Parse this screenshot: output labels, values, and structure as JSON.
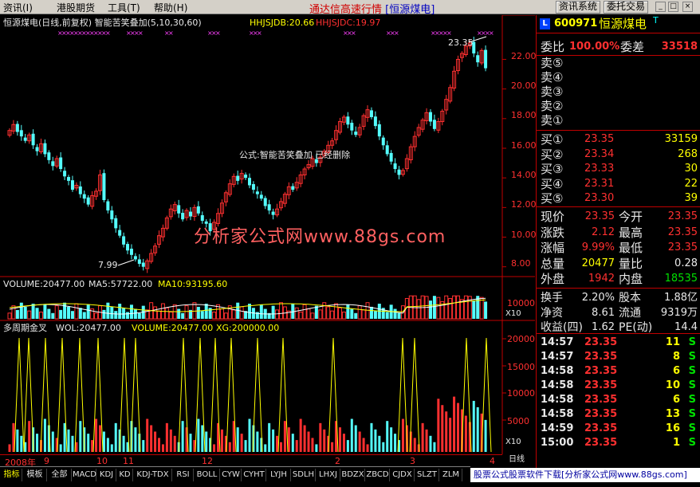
{
  "menu": {
    "items": [
      "资讯(I)",
      "港股期货",
      "工具(T)",
      "帮助(H)"
    ],
    "title_main": "通达信高速行情",
    "title_stock": "[恒源煤电]",
    "btn_news": "资讯系统",
    "btn_trade": "委托交易",
    "btn_min": "_",
    "btn_max": "□",
    "btn_close": "×"
  },
  "chart": {
    "header_title": "恒源煤电(日线,前复权) 智能苦笑叠加(5,10,30,60)",
    "hhjsjdb": "HHJSJDB:20.66",
    "hhjsjdc": "HHJSJDC:19.97",
    "formula_note": "公式:智能苦笑叠加 已经删除",
    "watermark": "分析家公式网www.88gs.com",
    "low_label": "7.99",
    "high_label": "23.35",
    "price_ticks": [
      "22.00",
      "20.00",
      "18.00",
      "16.00",
      "14.00",
      "12.00",
      "10.00",
      "8.00"
    ],
    "volume_header_a": "VOLUME:20477.00",
    "volume_header_b": "MA5:57722.00",
    "volume_header_c": "MA10:93195.60",
    "volume_tick": "10000",
    "volume_x10": "X10",
    "ind_header_a": "多周期金叉",
    "ind_header_b": "WOL:20477.00",
    "ind_header_c": "VOLUME:20477.00",
    "ind_header_d": "XG:200000.00",
    "ind_ticks": [
      "20000",
      "15000",
      "10000",
      "5000"
    ],
    "ind_x10": "X10",
    "time_labels": [
      "2008年",
      "9",
      "10",
      "11",
      "12",
      "2",
      "3",
      "4"
    ],
    "day_label": "日线",
    "colors": {
      "up": "#ff3030",
      "down": "#54fcfc",
      "yellow": "#ffff00",
      "grid": "#c00000"
    }
  },
  "chart_data": {
    "type": "candlestick",
    "price_range": [
      7.5,
      23.8
    ],
    "closes": [
      17.2,
      17.6,
      17.1,
      16.8,
      16.5,
      16.9,
      16.2,
      15.8,
      16.3,
      15.6,
      15.2,
      14.8,
      15.3,
      14.6,
      14.1,
      13.8,
      13.2,
      13.5,
      12.9,
      12.6,
      12.2,
      12.8,
      13.1,
      14.2,
      12.5,
      11.8,
      11.2,
      10.6,
      10.1,
      9.5,
      9.1,
      8.8,
      8.5,
      8.2,
      8.0,
      8.4,
      8.9,
      9.4,
      10.1,
      10.6,
      11.3,
      11.9,
      12.2,
      11.6,
      11.2,
      11.8,
      11.4,
      12.0,
      11.6,
      11.1,
      10.9,
      10.4,
      11.0,
      11.6,
      12.3,
      13.0,
      13.6,
      14.1,
      13.8,
      14.3,
      14.0,
      13.5,
      13.2,
      12.9,
      12.6,
      12.1,
      11.8,
      11.5,
      11.9,
      12.4,
      12.9,
      13.4,
      13.2,
      13.7,
      14.2,
      14.6,
      14.9,
      15.3,
      15.0,
      15.4,
      15.8,
      16.2,
      16.5,
      17.2,
      17.8,
      18.1,
      17.6,
      17.2,
      16.9,
      17.4,
      18.2,
      18.6,
      18.1,
      17.5,
      16.8,
      16.2,
      15.6,
      15.1,
      14.6,
      14.2,
      14.5,
      15.3,
      16.1,
      16.8,
      17.4,
      17.9,
      18.4,
      17.8,
      17.3,
      17.8,
      18.5,
      19.3,
      20.1,
      21.2,
      22.0,
      22.4,
      22.9,
      23.1,
      22.4,
      21.8,
      22.6,
      21.4
    ],
    "volume_header": "VOLUME:20477.00 MA5:57722.00 MA10:93195.60",
    "indicator_header": "多周期金叉 WOL:20477.00 VOLUME:20477.00 XG:200000.00"
  },
  "quote": {
    "code": "600971",
    "name": "恒源煤电",
    "logo": "L",
    "tag": "T",
    "weibi_label": "委比",
    "weibi_value": "100.00%",
    "weicha_label": "委差",
    "weicha_value": "33518",
    "sell": [
      {
        "label": "卖⑤",
        "price": "",
        "vol": ""
      },
      {
        "label": "卖④",
        "price": "",
        "vol": ""
      },
      {
        "label": "卖③",
        "price": "",
        "vol": ""
      },
      {
        "label": "卖②",
        "price": "",
        "vol": ""
      },
      {
        "label": "卖①",
        "price": "",
        "vol": ""
      }
    ],
    "buy": [
      {
        "label": "买①",
        "price": "23.35",
        "vol": "33159"
      },
      {
        "label": "买②",
        "price": "23.34",
        "vol": "268"
      },
      {
        "label": "买③",
        "price": "23.33",
        "vol": "30"
      },
      {
        "label": "买④",
        "price": "23.31",
        "vol": "22"
      },
      {
        "label": "买⑤",
        "price": "23.30",
        "vol": "39"
      }
    ],
    "stats": [
      {
        "l1": "现价",
        "v1": "23.35",
        "c1": "red",
        "l2": "今开",
        "v2": "23.35",
        "c2": "red"
      },
      {
        "l1": "涨跌",
        "v1": "2.12",
        "c1": "red",
        "l2": "最高",
        "v2": "23.35",
        "c2": "red"
      },
      {
        "l1": "涨幅",
        "v1": "9.99%",
        "c1": "red",
        "l2": "最低",
        "v2": "23.35",
        "c2": "red"
      },
      {
        "l1": "总量",
        "v1": "20477",
        "c1": "yel",
        "l2": "量比",
        "v2": "0.28",
        "c2": "wht"
      },
      {
        "l1": "外盘",
        "v1": "1942",
        "c1": "red",
        "l2": "内盘",
        "v2": "18535",
        "c2": "grn"
      }
    ],
    "stats2": [
      {
        "l1": "换手",
        "v1": "2.20%",
        "c1": "wht",
        "l2": "股本",
        "v2": "1.88亿",
        "c2": "wht"
      },
      {
        "l1": "净资",
        "v1": "8.61",
        "c1": "wht",
        "l2": "流通",
        "v2": "9319万",
        "c2": "wht"
      },
      {
        "l1": "收益(四)",
        "v1": "1.62",
        "c1": "wht",
        "l2": "PE(动)",
        "v2": "14.4",
        "c2": "wht"
      }
    ],
    "ticks": [
      {
        "time": "14:57",
        "price": "23.35",
        "vol": "11",
        "dir": "S"
      },
      {
        "time": "14:57",
        "price": "23.35",
        "vol": "8",
        "dir": "S"
      },
      {
        "time": "14:58",
        "price": "23.35",
        "vol": "6",
        "dir": "S"
      },
      {
        "time": "14:58",
        "price": "23.35",
        "vol": "10",
        "dir": "S"
      },
      {
        "time": "14:58",
        "price": "23.35",
        "vol": "6",
        "dir": "S"
      },
      {
        "time": "14:58",
        "price": "23.35",
        "vol": "13",
        "dir": "S"
      },
      {
        "time": "14:59",
        "price": "23.35",
        "vol": "16",
        "dir": "S"
      },
      {
        "time": "15:00",
        "price": "23.35",
        "vol": "1",
        "dir": "S"
      }
    ]
  },
  "tabs": [
    "指标",
    "模板",
    "全部",
    "MACD",
    "KDJ",
    "KD",
    "KDJ-TDX",
    "RSI",
    "BOLL",
    "CYW",
    "CYHT",
    "LYJH",
    "SDLH",
    "LHXJ",
    "BDZX",
    "ZBCD",
    "CJDX",
    "SLZT",
    "ZLM"
  ],
  "footer": "股票公式股票软件下载[分析家公式网www.88gs.com]"
}
